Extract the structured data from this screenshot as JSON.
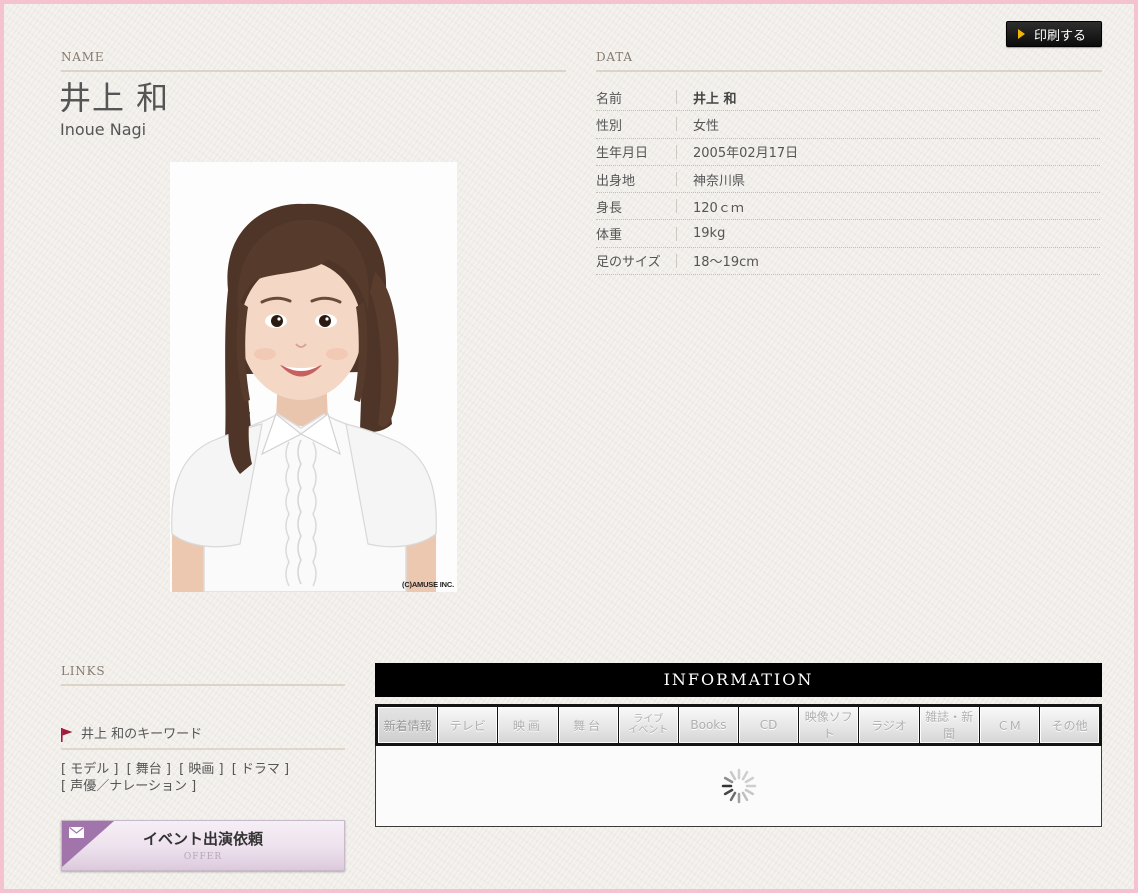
{
  "page": {
    "colors": {
      "frame": "#f5c3cf",
      "background": "#f1eeea",
      "text": "#555555",
      "heading": "#857b6f",
      "print_arrow": "#f2b705",
      "offer_accent": "#a274ac",
      "flag": "#a3193a",
      "info_bar": "#000000"
    }
  },
  "print_button": {
    "label": "印刷する",
    "icon": "play-triangle-icon"
  },
  "profile": {
    "heading": "NAME",
    "name_ja": "井上 和",
    "name_en": "Inoue Nagi",
    "photo": {
      "credit": "(C)AMUSE INC."
    }
  },
  "profile_data": {
    "heading": "DATA",
    "rows": [
      {
        "label": "名前",
        "value": "井上 和"
      },
      {
        "label": "性別",
        "value": "女性"
      },
      {
        "label": "生年月日",
        "value": "2005年02月17日"
      },
      {
        "label": "出身地",
        "value": "神奈川県"
      },
      {
        "label": "身長",
        "value": "120ｃｍ"
      },
      {
        "label": "体重",
        "value": "19kg"
      },
      {
        "label": "足のサイズ",
        "value": "18〜19cm"
      }
    ]
  },
  "links": {
    "heading": "LINKS",
    "keyword_title": "井上 和のキーワード",
    "keyword_icon": "flag-icon",
    "keywords": [
      "[ モデル ]",
      "[ 舞台 ]",
      "[ 映画 ]",
      "[ ドラマ ]",
      "[ 声優／ナレーション ]"
    ]
  },
  "offer_button": {
    "label": "イベント出演依頼",
    "sublabel": "OFFER",
    "icon": "envelope-icon"
  },
  "information": {
    "heading": "INFORMATION",
    "tabs": [
      {
        "label": "新着情報",
        "active": true
      },
      {
        "label": "テレビ",
        "active": false
      },
      {
        "label": "映画",
        "active": false
      },
      {
        "label": "舞台",
        "active": false
      },
      {
        "label": "ライブ\nイベント",
        "active": false
      },
      {
        "label": "Books",
        "active": false
      },
      {
        "label": "CD",
        "active": false
      },
      {
        "label": "映像ソフト",
        "active": false
      },
      {
        "label": "ラジオ",
        "active": false
      },
      {
        "label": "雑誌・新聞",
        "active": false
      },
      {
        "label": "ＣＭ",
        "active": false
      },
      {
        "label": "その他",
        "active": false
      }
    ],
    "content_icon": "loading-spinner-icon"
  }
}
